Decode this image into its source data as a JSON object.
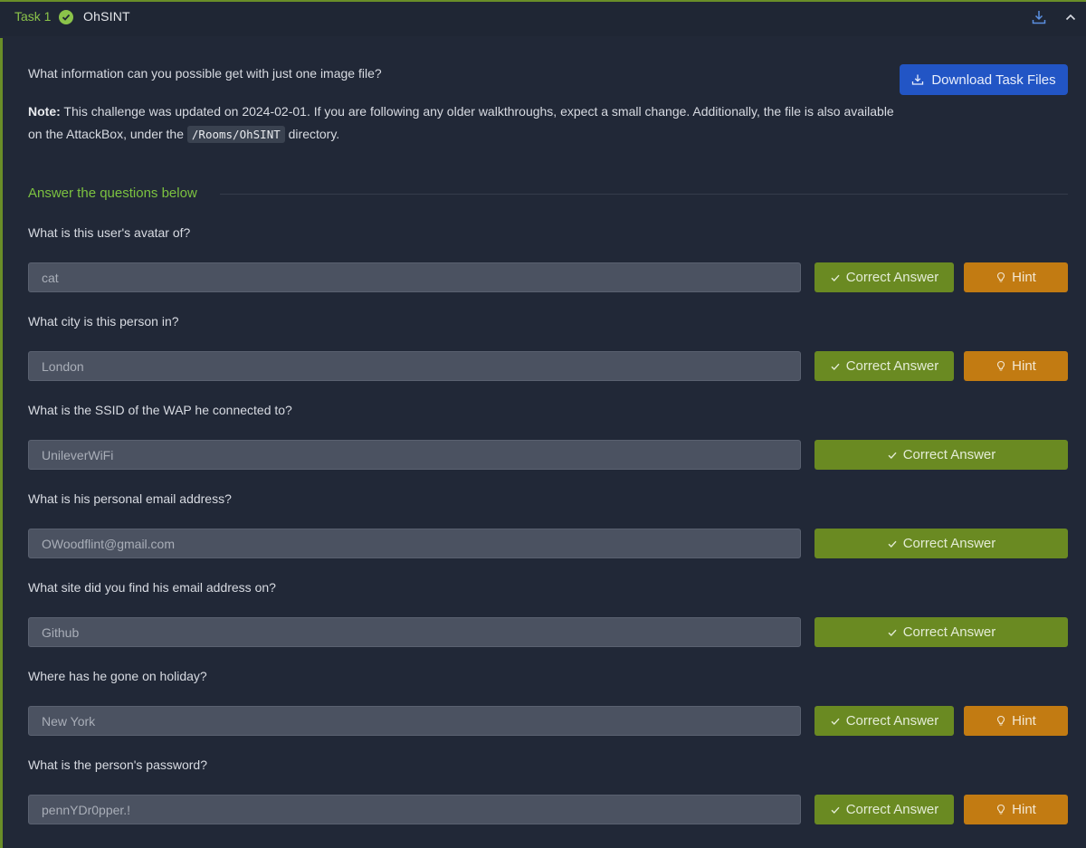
{
  "task": {
    "label": "Task 1",
    "title": "OhSINT"
  },
  "intro": "What information can you possible get with just one image file?",
  "note": {
    "bold": "Note:",
    "text_before": " This challenge was updated on 2024-02-01. If you are following any older walkthroughs, expect a small change. Additionally, the file is also available on the AttackBox, under the ",
    "code": "/Rooms/OhSINT",
    "text_after": " directory."
  },
  "download_label": "Download Task Files",
  "answers_title": "Answer the questions below",
  "correct_label": "Correct Answer",
  "hint_label": "Hint",
  "questions": [
    {
      "question": "What is this user's avatar of?",
      "answer": "cat",
      "has_hint": true
    },
    {
      "question": "What city is this person in?",
      "answer": "London",
      "has_hint": true
    },
    {
      "question": "What is the SSID of the WAP he connected to?",
      "answer": "UnileverWiFi",
      "has_hint": false
    },
    {
      "question": "What is his personal email address?",
      "answer": "OWoodflint@gmail.com",
      "has_hint": false
    },
    {
      "question": "What site did you find his email address on?",
      "answer": "Github",
      "has_hint": false
    },
    {
      "question": "Where has he gone on holiday?",
      "answer": "New York",
      "has_hint": true
    },
    {
      "question": "What is the person's password?",
      "answer": "pennYDr0pper.!",
      "has_hint": true
    }
  ],
  "colors": {
    "accent_green": "#8bc34a",
    "correct_bg": "#6a8a22",
    "hint_bg": "#c27b12",
    "download_bg": "#2255c5"
  }
}
